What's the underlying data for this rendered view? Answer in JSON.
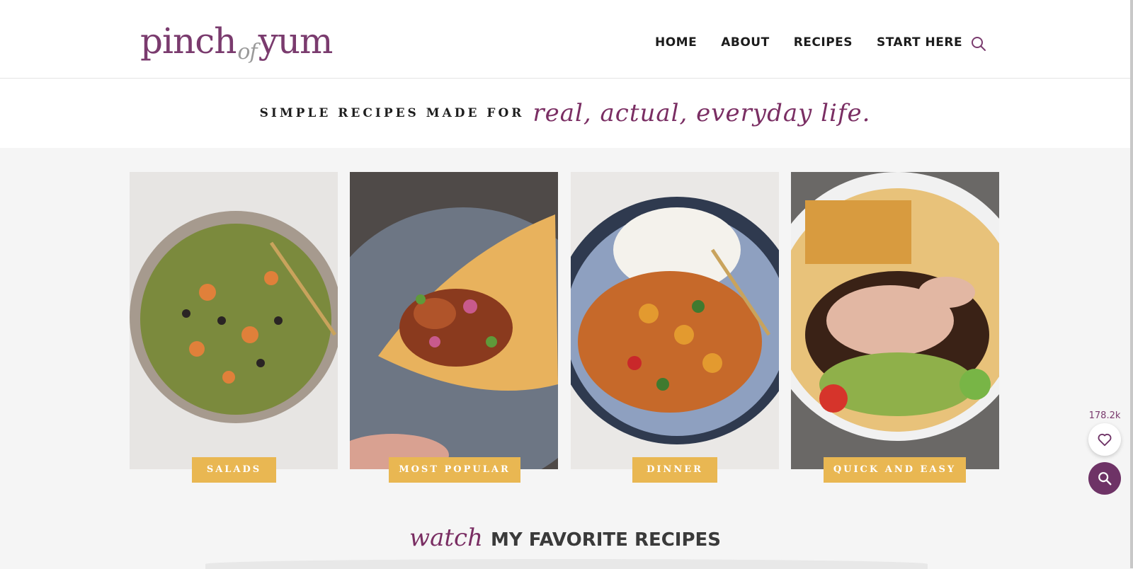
{
  "logo": {
    "left": "pinch",
    "mid": "of",
    "right": "yum"
  },
  "nav": [
    {
      "label": "HOME"
    },
    {
      "label": "ABOUT"
    },
    {
      "label": "RECIPES"
    },
    {
      "label": "START HERE"
    }
  ],
  "tagline": {
    "plain": "SIMPLE RECIPES MADE FOR",
    "script": "real, actual, everyday life."
  },
  "categories": [
    {
      "label": "SALADS",
      "icon": "salad-bowl-photo"
    },
    {
      "label": "MOST POPULAR",
      "icon": "taco-plate-photo"
    },
    {
      "label": "DINNER",
      "icon": "curry-bowl-photo"
    },
    {
      "label": "QUICK AND EASY",
      "icon": "burger-bowl-photo"
    }
  ],
  "watch": {
    "script": "watch",
    "bold": "MY FAVORITE RECIPES"
  },
  "floating": {
    "favorites_count": "178.2k"
  },
  "colors": {
    "brand_purple": "#7a2e63",
    "label_gold": "#e9b752"
  }
}
